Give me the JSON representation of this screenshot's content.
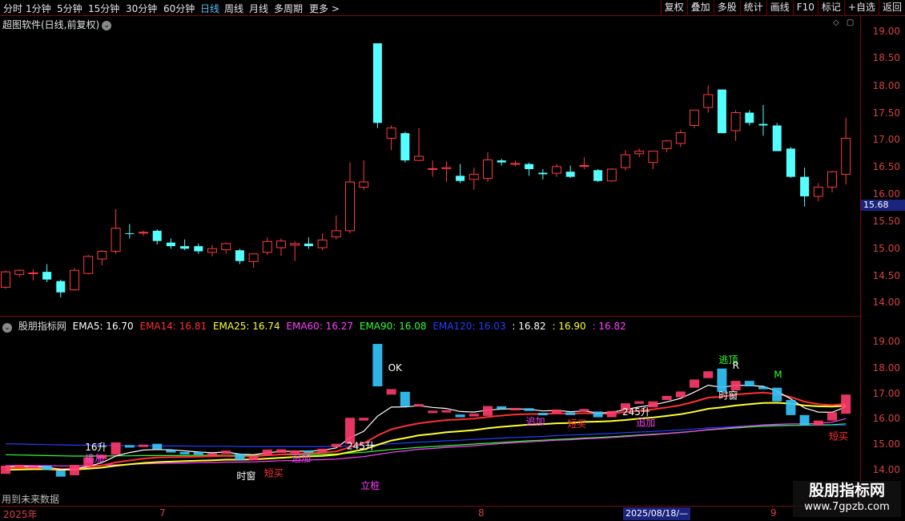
{
  "toolbar": {
    "periods": [
      {
        "label": "分时",
        "active": false
      },
      {
        "label": "1分钟",
        "active": false
      },
      {
        "label": "5分钟",
        "active": false
      },
      {
        "label": "15分钟",
        "active": false
      },
      {
        "label": "30分钟",
        "active": false
      },
      {
        "label": "60分钟",
        "active": false
      },
      {
        "label": "日线",
        "active": true
      },
      {
        "label": "周线",
        "active": false
      },
      {
        "label": "月线",
        "active": false
      },
      {
        "label": "多周期",
        "active": false
      },
      {
        "label": "更多 >",
        "active": false
      }
    ],
    "right_buttons": [
      "复权",
      "叠加",
      "多股",
      "统计",
      "画线",
      "F10",
      "标记",
      "+自选",
      "返回"
    ]
  },
  "main_panel": {
    "title": "超图软件(日线,前复权)",
    "price_ticks": [
      "19.00",
      "18.50",
      "18.00",
      "17.50",
      "17.00",
      "16.50",
      "16.00",
      "15.50",
      "15.00",
      "14.50",
      "14.00"
    ],
    "current_price": "15.68"
  },
  "sub_panel": {
    "indicator_name": "股朋指标网",
    "legend": [
      {
        "text": "EMA5: 16.70",
        "color": "#ffffff"
      },
      {
        "text": "EMA14: 16.81",
        "color": "#ff3030"
      },
      {
        "text": "EMA25: 16.74",
        "color": "#ffff30"
      },
      {
        "text": "EMA60: 16.27",
        "color": "#ff40ff"
      },
      {
        "text": "EMA90: 16.08",
        "color": "#30ff30"
      },
      {
        "text": "EMA120: 16.03",
        "color": "#2040ff"
      },
      {
        "text": ": 16.82",
        "color": "#ffffff"
      },
      {
        "text": ": 16.90",
        "color": "#ffff30"
      },
      {
        "text": ": 16.82",
        "color": "#ff40ff"
      }
    ],
    "price_ticks": [
      "19.00",
      "18.00",
      "17.00",
      "16.00",
      "15.00",
      "14.00"
    ],
    "signals": [
      {
        "text": "16升",
        "color": "#ffffff"
      },
      {
        "text": "追加",
        "color": "#ff40ff"
      },
      {
        "text": "时窗",
        "color": "#ffffff"
      },
      {
        "text": "短买",
        "color": "#ff3030"
      },
      {
        "text": "追加",
        "color": "#ff40ff"
      },
      {
        "text": "245升",
        "color": "#ffffff"
      },
      {
        "text": "立桩",
        "color": "#ff40ff"
      },
      {
        "text": "OK",
        "color": "#ffffff"
      },
      {
        "text": "追加",
        "color": "#ff40ff"
      },
      {
        "text": "短买",
        "color": "#ff3030"
      },
      {
        "text": "245升",
        "color": "#ffffff"
      },
      {
        "text": "追加",
        "color": "#ff40ff"
      },
      {
        "text": "逃顶",
        "color": "#30ff30"
      },
      {
        "text": "R",
        "color": "#ffffff"
      },
      {
        "text": "时窗",
        "color": "#ffffff"
      },
      {
        "text": "M",
        "color": "#30ff30"
      },
      {
        "text": "短买",
        "color": "#ff3030"
      }
    ]
  },
  "date_axis": {
    "labels": [
      "2025年",
      "7",
      "8",
      "9"
    ],
    "cursor_label": "2025/08/18/—"
  },
  "footer_note": "用到未来数据",
  "watermark": {
    "title": "股朋指标网",
    "url": "www.7gpzb.com"
  },
  "colors": {
    "up": "#ff3b3b",
    "down": "#54ffff",
    "background": "#000000",
    "grid": "#7a0a0a"
  },
  "chart_data": [
    {
      "type": "candlestick",
      "title": "超图软件(日线,前复权)",
      "ylim": [
        13.85,
        19.25
      ],
      "x": [
        "d1",
        "d2",
        "d3",
        "d4",
        "d5",
        "d6",
        "d7",
        "d8",
        "d9",
        "d10",
        "d11",
        "d12",
        "d13",
        "d14",
        "d15",
        "d16",
        "d17",
        "d18",
        "d19",
        "d20",
        "d21",
        "d22",
        "d23",
        "d24",
        "d25",
        "d26",
        "d27",
        "d28",
        "d29",
        "d30",
        "d31",
        "d32",
        "d33",
        "d34",
        "d35",
        "d36",
        "d37",
        "d38",
        "d39",
        "d40",
        "d41",
        "d42",
        "d43",
        "d44",
        "d45",
        "d46",
        "d47",
        "d48",
        "d49",
        "d50",
        "d51",
        "d52",
        "d53",
        "d54",
        "d55",
        "d56",
        "d57",
        "d58",
        "d59",
        "d60",
        "d61",
        "d62",
        "d63"
      ],
      "ohlc": [
        [
          14.25,
          14.58,
          14.22,
          14.55
        ],
        [
          14.5,
          14.6,
          14.45,
          14.58
        ],
        [
          14.53,
          14.6,
          14.38,
          14.53
        ],
        [
          14.55,
          14.7,
          14.35,
          14.4
        ],
        [
          14.37,
          14.4,
          14.05,
          14.15
        ],
        [
          14.2,
          14.62,
          14.18,
          14.58
        ],
        [
          14.52,
          14.88,
          14.5,
          14.85
        ],
        [
          14.8,
          14.97,
          14.68,
          14.95
        ],
        [
          14.95,
          15.77,
          14.9,
          15.4
        ],
        [
          15.3,
          15.48,
          15.2,
          15.29
        ],
        [
          15.31,
          15.35,
          15.25,
          15.32
        ],
        [
          15.35,
          15.38,
          15.08,
          15.15
        ],
        [
          15.12,
          15.2,
          15.0,
          15.05
        ],
        [
          15.05,
          15.18,
          14.97,
          15.0
        ],
        [
          15.05,
          15.1,
          14.9,
          14.95
        ],
        [
          14.93,
          15.07,
          14.85,
          15.0
        ],
        [
          14.98,
          15.12,
          14.9,
          15.1
        ],
        [
          14.97,
          15.0,
          14.7,
          14.76
        ],
        [
          14.75,
          14.91,
          14.63,
          14.9
        ],
        [
          14.93,
          15.22,
          14.88,
          15.14
        ],
        [
          15.02,
          15.2,
          14.86,
          15.15
        ],
        [
          15.07,
          15.14,
          14.76,
          15.1
        ],
        [
          15.1,
          15.22,
          15.0,
          15.05
        ],
        [
          15.02,
          15.3,
          14.97,
          15.17
        ],
        [
          15.23,
          15.65,
          15.18,
          15.35
        ],
        [
          15.35,
          16.68,
          15.3,
          16.3
        ],
        [
          16.2,
          16.72,
          16.14,
          16.3
        ],
        [
          19.0,
          19.0,
          17.35,
          17.45
        ],
        [
          17.15,
          17.4,
          16.92,
          17.35
        ],
        [
          17.25,
          17.28,
          16.68,
          16.72
        ],
        [
          16.72,
          17.35,
          16.7,
          16.8
        ],
        [
          16.56,
          16.72,
          16.4,
          16.56
        ],
        [
          16.56,
          16.7,
          16.3,
          16.58
        ],
        [
          16.42,
          16.65,
          16.28,
          16.32
        ],
        [
          16.35,
          16.58,
          16.15,
          16.45
        ],
        [
          16.37,
          16.88,
          16.3,
          16.73
        ],
        [
          16.72,
          16.75,
          16.62,
          16.68
        ],
        [
          16.66,
          16.72,
          16.6,
          16.66
        ],
        [
          16.65,
          16.68,
          16.42,
          16.55
        ],
        [
          16.48,
          16.55,
          16.35,
          16.45
        ],
        [
          16.47,
          16.65,
          16.4,
          16.6
        ],
        [
          16.5,
          16.62,
          16.38,
          16.4
        ],
        [
          16.62,
          16.78,
          16.55,
          16.62
        ],
        [
          16.53,
          16.55,
          16.3,
          16.32
        ],
        [
          16.32,
          16.57,
          16.3,
          16.55
        ],
        [
          16.58,
          16.92,
          16.52,
          16.83
        ],
        [
          16.85,
          16.95,
          16.78,
          16.9
        ],
        [
          16.68,
          16.85,
          16.55,
          16.9
        ],
        [
          16.95,
          17.12,
          16.88,
          17.1
        ],
        [
          17.05,
          17.32,
          16.98,
          17.26
        ],
        [
          17.4,
          17.7,
          17.35,
          17.7
        ],
        [
          17.75,
          18.18,
          17.65,
          18.0
        ],
        [
          18.1,
          18.1,
          17.25,
          17.25
        ],
        [
          17.3,
          17.7,
          17.1,
          17.65
        ],
        [
          17.65,
          17.7,
          17.4,
          17.45
        ],
        [
          17.43,
          17.8,
          17.2,
          17.4
        ],
        [
          17.4,
          17.45,
          16.9,
          16.9
        ],
        [
          16.95,
          16.98,
          16.38,
          16.4
        ],
        [
          16.4,
          16.58,
          15.82,
          16.02
        ],
        [
          16.02,
          16.28,
          15.92,
          16.2
        ],
        [
          16.2,
          16.52,
          16.1,
          16.5
        ],
        [
          16.45,
          17.55,
          16.25,
          17.15
        ]
      ]
    },
    {
      "type": "line",
      "title": "股朋指标网",
      "ylim": [
        13.7,
        19.5
      ],
      "series": [
        {
          "name": "EMA5",
          "color": "#ffffff",
          "values": [
            14.5,
            14.53,
            14.52,
            14.5,
            14.41,
            14.43,
            14.52,
            14.66,
            14.9,
            15.03,
            15.12,
            15.14,
            15.13,
            15.09,
            15.05,
            15.02,
            15.05,
            14.97,
            14.95,
            15.02,
            15.07,
            15.08,
            15.08,
            15.11,
            15.2,
            15.57,
            15.81,
            16.36,
            16.69,
            16.7,
            16.74,
            16.68,
            16.64,
            16.53,
            16.51,
            16.58,
            16.62,
            16.63,
            16.61,
            16.55,
            16.57,
            16.52,
            16.55,
            16.47,
            16.5,
            16.6,
            16.7,
            16.77,
            16.88,
            17.01,
            17.24,
            17.49,
            17.41,
            17.49,
            17.48,
            17.45,
            17.27,
            16.99,
            16.66,
            16.51,
            16.5,
            16.7
          ]
        },
        {
          "name": "EMA14",
          "color": "#ff3030",
          "values": [
            14.45,
            14.47,
            14.48,
            14.47,
            14.43,
            14.45,
            14.5,
            14.56,
            14.67,
            14.74,
            14.81,
            14.85,
            14.86,
            14.87,
            14.88,
            14.89,
            14.91,
            14.89,
            14.89,
            14.93,
            14.96,
            14.99,
            15.0,
            15.03,
            15.07,
            15.23,
            15.37,
            15.65,
            15.88,
            16.0,
            16.1,
            16.16,
            16.22,
            16.24,
            16.27,
            16.33,
            16.38,
            16.42,
            16.44,
            16.44,
            16.46,
            16.45,
            16.47,
            16.45,
            16.46,
            16.51,
            16.56,
            16.61,
            16.68,
            16.76,
            16.89,
            17.04,
            17.07,
            17.15,
            17.19,
            17.22,
            17.17,
            17.06,
            16.89,
            16.8,
            16.76,
            16.81
          ]
        },
        {
          "name": "EMA25",
          "color": "#ffff30",
          "values": [
            14.4,
            14.41,
            14.42,
            14.42,
            14.4,
            14.41,
            14.44,
            14.48,
            14.55,
            14.6,
            14.65,
            14.68,
            14.7,
            14.72,
            14.73,
            14.75,
            14.77,
            14.77,
            14.78,
            14.81,
            14.84,
            14.87,
            14.89,
            14.91,
            14.95,
            15.05,
            15.14,
            15.31,
            15.47,
            15.56,
            15.66,
            15.71,
            15.77,
            15.81,
            15.85,
            15.92,
            15.97,
            16.01,
            16.05,
            16.07,
            16.1,
            16.11,
            16.15,
            16.16,
            16.18,
            16.22,
            16.27,
            16.31,
            16.37,
            16.43,
            16.52,
            16.63,
            16.68,
            16.75,
            16.8,
            16.84,
            16.85,
            16.82,
            16.75,
            16.72,
            16.71,
            16.74
          ]
        },
        {
          "name": "EMA60",
          "color": "#ff40ff",
          "values": [
            14.55,
            14.55,
            14.55,
            14.55,
            14.54,
            14.54,
            14.55,
            14.56,
            14.58,
            14.6,
            14.62,
            14.63,
            14.64,
            14.65,
            14.66,
            14.67,
            14.68,
            14.68,
            14.69,
            14.71,
            14.73,
            14.74,
            14.76,
            14.77,
            14.79,
            14.84,
            14.88,
            14.96,
            15.04,
            15.09,
            15.15,
            15.18,
            15.22,
            15.25,
            15.28,
            15.32,
            15.36,
            15.39,
            15.42,
            15.45,
            15.48,
            15.5,
            15.53,
            15.55,
            15.58,
            15.61,
            15.65,
            15.68,
            15.72,
            15.76,
            15.81,
            15.87,
            15.91,
            15.96,
            16.0,
            16.04,
            16.06,
            16.08,
            16.08,
            16.1,
            16.14,
            16.27
          ]
        },
        {
          "name": "EMA90",
          "color": "#30ff30",
          "values": [
            14.95,
            14.94,
            14.93,
            14.92,
            14.91,
            14.9,
            14.9,
            14.9,
            14.91,
            14.91,
            14.92,
            14.92,
            14.92,
            14.92,
            14.93,
            14.93,
            14.93,
            14.93,
            14.93,
            14.94,
            14.95,
            14.95,
            14.96,
            14.97,
            14.98,
            15.01,
            15.04,
            15.09,
            15.14,
            15.18,
            15.22,
            15.25,
            15.28,
            15.31,
            15.34,
            15.37,
            15.4,
            15.43,
            15.46,
            15.48,
            15.51,
            15.53,
            15.56,
            15.58,
            15.61,
            15.64,
            15.67,
            15.7,
            15.73,
            15.77,
            15.81,
            15.86,
            15.89,
            15.93,
            15.96,
            15.99,
            16.01,
            16.02,
            16.03,
            16.04,
            16.05,
            16.08
          ]
        },
        {
          "name": "EMA120",
          "color": "#2040ff",
          "values": [
            15.35,
            15.34,
            15.33,
            15.32,
            15.31,
            15.3,
            15.3,
            15.29,
            15.29,
            15.28,
            15.28,
            15.28,
            15.27,
            15.27,
            15.26,
            15.26,
            15.26,
            15.25,
            15.25,
            15.25,
            15.25,
            15.25,
            15.25,
            15.25,
            15.26,
            15.27,
            15.29,
            15.32,
            15.35,
            15.38,
            15.41,
            15.43,
            15.46,
            15.48,
            15.51,
            15.53,
            15.56,
            15.58,
            15.6,
            15.62,
            15.65,
            15.67,
            15.69,
            15.71,
            15.73,
            15.76,
            15.78,
            15.8,
            15.83,
            15.86,
            15.89,
            15.93,
            15.95,
            15.98,
            16.0,
            16.02,
            16.03,
            16.03,
            16.03,
            16.03,
            16.03,
            16.03
          ]
        }
      ]
    }
  ]
}
